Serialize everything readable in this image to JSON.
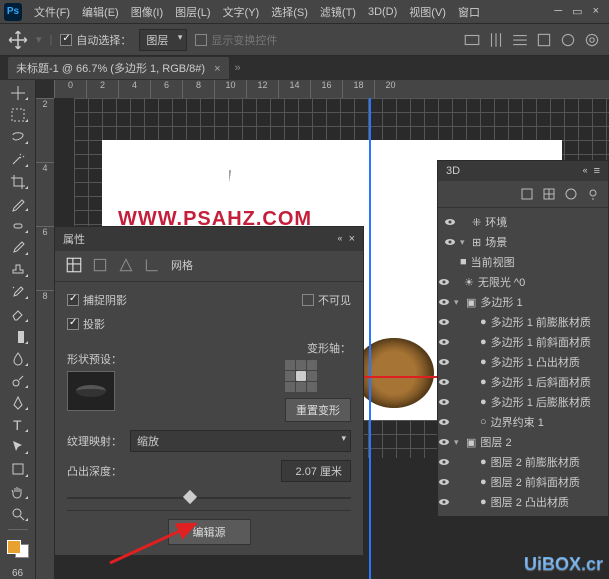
{
  "menu": {
    "file": "文件(F)",
    "edit": "编辑(E)",
    "image": "图像(I)",
    "layer": "图层(L)",
    "type": "文字(Y)",
    "select": "选择(S)",
    "filter": "滤镜(T)",
    "threeD": "3D(D)",
    "view": "视图(V)",
    "window": "窗口"
  },
  "optbar": {
    "autoSelect": "自动选择：",
    "target": "图层",
    "showTransform": "显示变换控件"
  },
  "doc": {
    "title": "未标题-1 @ 66.7% (多边形 1, RGB/8#)",
    "close": "×"
  },
  "rulerH": [
    "0",
    "2",
    "4",
    "6",
    "8",
    "10",
    "12",
    "14",
    "16",
    "18",
    "20"
  ],
  "rulerV": [
    "2",
    "4",
    "6",
    "8"
  ],
  "zoom": "66",
  "watermark": "WWW.PSAHZ.COM",
  "watermark2": "UiBOX.cr",
  "panel3d": {
    "title": "3D",
    "items": {
      "env": "环境",
      "scene": "场景",
      "currentView": "当前视图",
      "infiniteLight": "无限光 ^0",
      "polygon1": "多边形 1",
      "poly1front": "多边形 1 前膨胀材质",
      "poly1bevelF": "多边形 1 前斜面材质",
      "poly1extrude": "多边形 1 凸出材质",
      "poly1bevelB": "多边形 1 后斜面材质",
      "poly1back": "多边形 1 后膨胀材质",
      "boundary": "边界约束 1",
      "layer2": "图层 2",
      "layer2front": "图层 2 前膨胀材质",
      "layer2bevelF": "图层 2 前斜面材质",
      "layer2extrude": "图层 2 凸出材质"
    }
  },
  "props": {
    "title": "属性",
    "subtab": "网格",
    "captureShadow": "捕捉阴影",
    "invisible": "不可见",
    "castShadow": "投影",
    "shapePreset": "形状预设：",
    "deformAxis": "变形轴：",
    "resetDeform": "重置变形",
    "textureMapping": "纹理映射：",
    "textureMode": "缩放",
    "extrudeDepth": "凸出深度：",
    "extrudeValue": "2.07 厘米",
    "editSource": "编辑源"
  }
}
